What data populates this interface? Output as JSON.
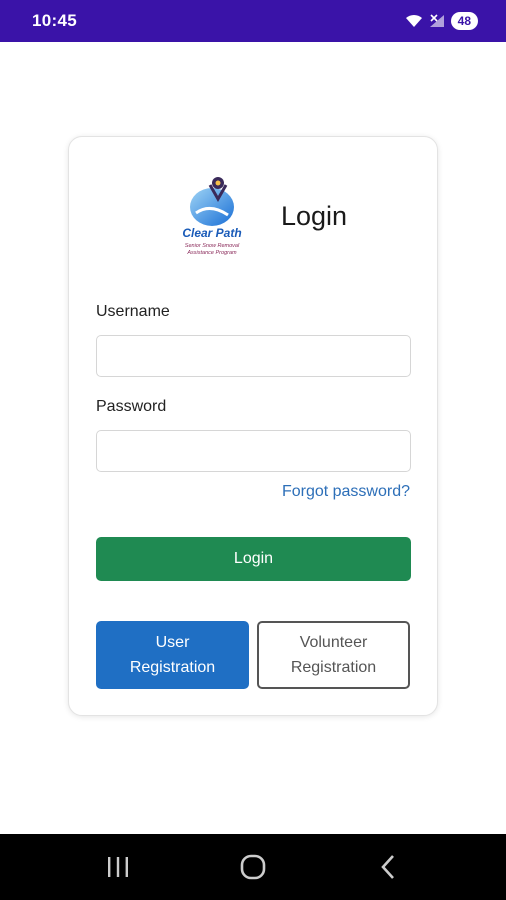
{
  "status_bar": {
    "time": "10:45",
    "battery": "48",
    "background": "#3a13a8",
    "icons": [
      "wifi-icon",
      "signal-icon",
      "battery-icon"
    ]
  },
  "login_card": {
    "title": "Login",
    "logo": {
      "name": "Clear Path",
      "subtitle_line1": "Senior Snow Removal",
      "subtitle_line2": "Assistance Program"
    },
    "username": {
      "label": "Username",
      "value": "",
      "placeholder": ""
    },
    "password": {
      "label": "Password",
      "value": "",
      "placeholder": ""
    },
    "forgot_password": "Forgot password?",
    "login_button": "Login",
    "user_registration": {
      "line1": "User",
      "line2": "Registration"
    },
    "volunteer_registration": {
      "line1": "Volunteer",
      "line2": "Registration"
    }
  },
  "colors": {
    "login_green": "#1f8a52",
    "user_reg_blue": "#1f6fc4",
    "link_blue": "#2d6fb8"
  },
  "nav_bar": {
    "icons": [
      "recent-apps-icon",
      "home-icon",
      "back-icon"
    ]
  }
}
